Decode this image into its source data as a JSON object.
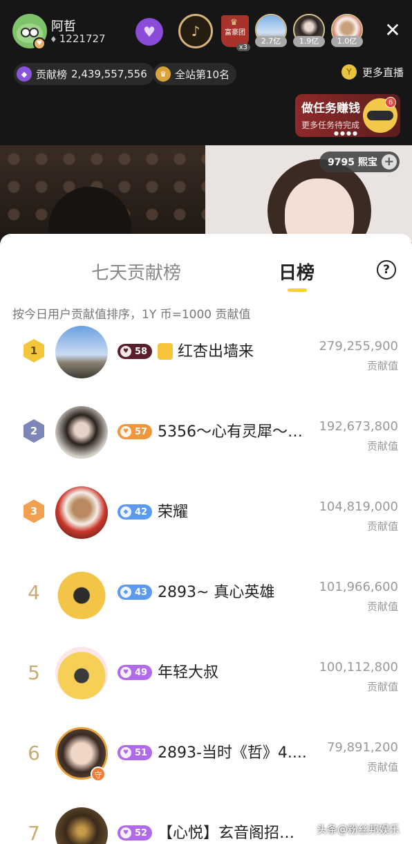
{
  "host": {
    "name": "阿哲",
    "id": "1221727",
    "badge": "♥"
  },
  "top_fans": [
    {
      "value": "2.7亿"
    },
    {
      "value": "1.9亿"
    },
    {
      "value": "1.0亿"
    }
  ],
  "fuhao_group": {
    "label": "富豪团",
    "multiplier": "x3"
  },
  "contribution_pill": {
    "label": "贡献榜",
    "value": "2,439,557,556"
  },
  "rank_pill": {
    "label": "全站第10名"
  },
  "more_live": {
    "label": "更多直播"
  },
  "task_card": {
    "title": "做任务赚钱",
    "subtitle": "更多任务待完成",
    "badge": "6"
  },
  "xibao": {
    "label": "9795 熙宝"
  },
  "tabs": {
    "week": "七天贡献榜",
    "day": "日榜"
  },
  "help_label": "?",
  "description": "按今日用户贡献值排序，1Y 币=1000 贡献值",
  "score_label": "贡献值",
  "ranking": [
    {
      "rank": "1",
      "level": "58",
      "level_color": "#5a1f2c",
      "name": "红杏出墙来",
      "score": "279,255,900"
    },
    {
      "rank": "2",
      "level": "57",
      "level_color": "#f0973c",
      "name": "5356～心有灵犀～…",
      "score": "192,673,800"
    },
    {
      "rank": "3",
      "level": "42",
      "level_color": "#5b9af0",
      "name": "荣耀",
      "score": "104,819,000"
    },
    {
      "rank": "4",
      "level": "43",
      "level_color": "#5b9af0",
      "name": "2893~ 真心英雄",
      "score": "101,966,600"
    },
    {
      "rank": "5",
      "level": "49",
      "level_color": "#b06be8",
      "name": "年轻大叔",
      "score": "100,112,800"
    },
    {
      "rank": "6",
      "level": "51",
      "level_color": "#b06be8",
      "name": "2893-当时《哲》4....",
      "score": "79,891,200"
    },
    {
      "rank": "7",
      "level": "52",
      "level_color": "#b06be8",
      "name": "【心悦】玄音阁招…",
      "score": ""
    }
  ],
  "guard_label": "守",
  "watermark": "头条@粉丝邦娱乐",
  "colors": {
    "accent": "#f7d428",
    "gold": "#c9ab72"
  }
}
